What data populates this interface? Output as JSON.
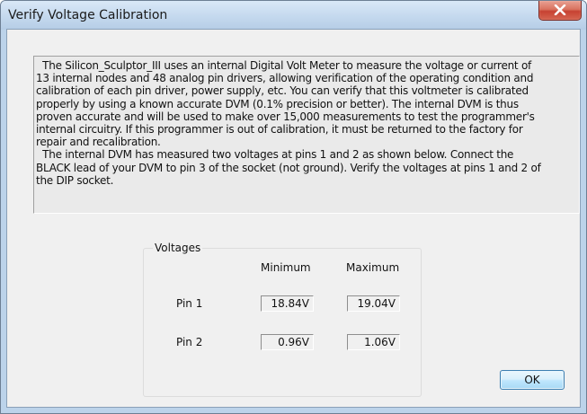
{
  "window": {
    "title": "Verify Voltage Calibration",
    "close_icon": "close-icon"
  },
  "description": "  The Silicon_Sculptor_III uses an internal Digital Volt Meter to measure the voltage or current of\n13 internal nodes and 48 analog pin drivers, allowing verification of the operating condition and\ncalibration of each pin driver, power supply, etc. You can verify that this voltmeter is calibrated\nproperly by using a known accurate DVM (0.1% precision or better). The internal DVM is thus\nproven accurate and will be used to make over 15,000 measurements to test the programmer's\ninternal circuitry. If this programmer is out of calibration, it must be returned to the factory for\nrepair and recalibration.\n  The internal DVM has measured two voltages at pins 1 and 2 as shown below. Connect the\nBLACK lead of your DVM to pin 3 of the socket (not ground). Verify the voltages at pins 1 and 2 of\nthe DIP socket.",
  "voltages": {
    "group_label": "Voltages",
    "min_header": "Minimum",
    "max_header": "Maximum",
    "rows": [
      {
        "label": "Pin 1",
        "min": "18.84V",
        "max": "19.04V"
      },
      {
        "label": "Pin 2",
        "min": "0.96V",
        "max": "1.06V"
      }
    ]
  },
  "buttons": {
    "ok_label": "OK"
  }
}
